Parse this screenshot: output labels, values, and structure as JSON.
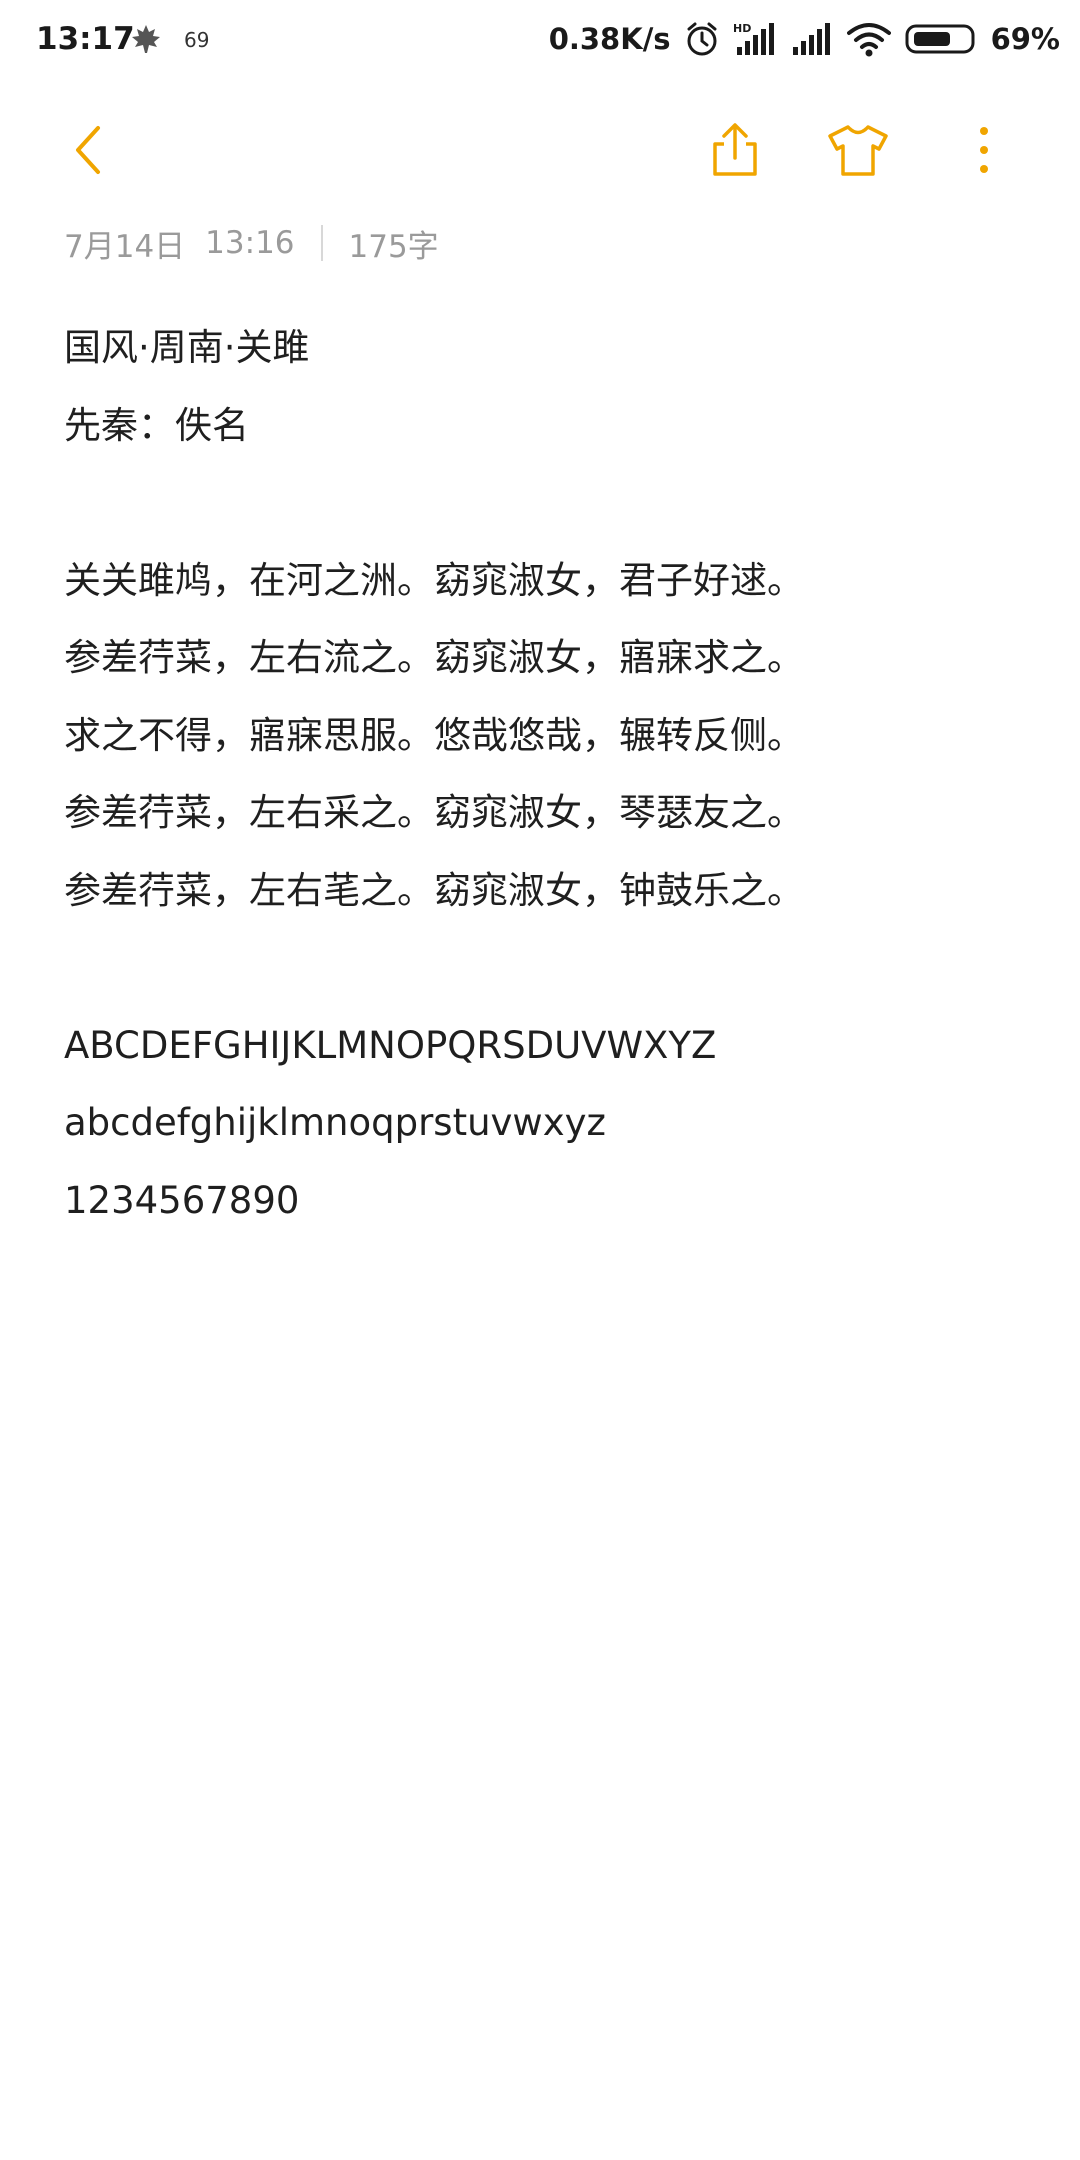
{
  "status_bar": {
    "time": "13:17",
    "notification_icon": "maple-leaf-icon",
    "notification_count": "69",
    "net_speed": "0.38K/s",
    "icons": [
      "alarm-icon",
      "hd-signal-icon",
      "signal-icon",
      "wifi-icon",
      "battery-icon"
    ],
    "battery_percent": "69%",
    "battery_level": 0.69
  },
  "toolbar": {
    "back_icon": "chevron-left-icon",
    "share_icon": "share-icon",
    "theme_icon": "tshirt-icon",
    "more_icon": "more-vertical-icon",
    "accent_color": "#F0A500"
  },
  "meta": {
    "date": "7月14日",
    "time": "13:16",
    "word_count": "175字"
  },
  "note": {
    "lines": [
      "国风·周南·关雎",
      "先秦：佚名",
      "",
      "关关雎鸠，在河之洲。窈窕淑女，君子好逑。",
      "参差荇菜，左右流之。窈窕淑女，寤寐求之。",
      "求之不得，寤寐思服。悠哉悠哉，辗转反侧。",
      "参差荇菜，左右采之。窈窕淑女，琴瑟友之。",
      "参差荇菜，左右芼之。窈窕淑女，钟鼓乐之。",
      "",
      "ABCDEFGHIJKLMNOPQRSDUVWXYZ",
      "abcdefghijklmnoqprstuvwxyz",
      "1234567890"
    ]
  }
}
